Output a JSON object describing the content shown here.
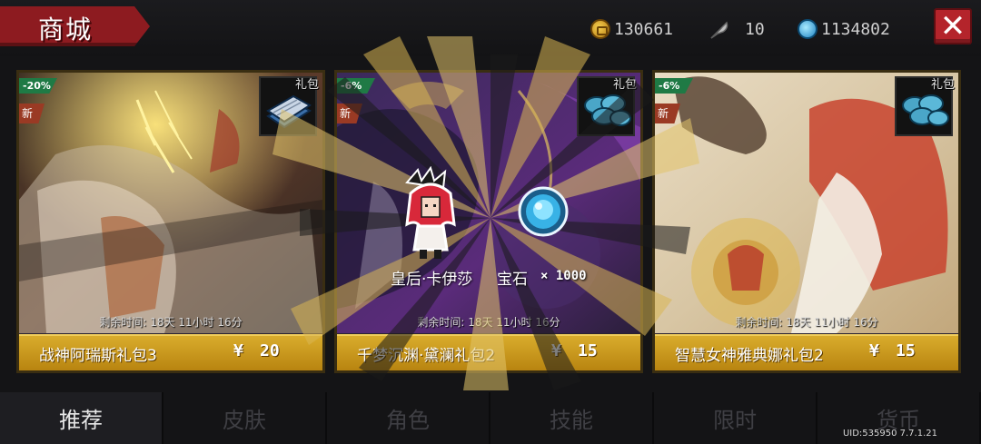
{
  "header": {
    "title": "商城",
    "close_icon": "close-x-icon"
  },
  "currencies": [
    {
      "icon": "gold-coin-icon",
      "value": "130661"
    },
    {
      "icon": "feather-icon",
      "value": "10"
    },
    {
      "icon": "blue-gem-icon",
      "value": "1134802"
    }
  ],
  "cards": [
    {
      "discount": "-20%",
      "new_label": "新",
      "pack_label": "礼包",
      "pack_icon": "book-icon",
      "timer": "剩余时间: 18天 11小时 16分",
      "name": "战神阿瑞斯礼包3",
      "currency_symbol": "¥",
      "price": "20"
    },
    {
      "discount": "-6%",
      "new_label": "新",
      "pack_label": "礼包",
      "pack_icon": "gem-stack-icon",
      "timer": "剩余时间: 18天 11小时 16分",
      "name": "千梦沉渊·黛澜礼包2",
      "currency_symbol": "¥",
      "price": "15"
    },
    {
      "discount": "-6%",
      "new_label": "新",
      "pack_label": "礼包",
      "pack_icon": "gem-stack-icon",
      "timer": "剩余时间: 18天 11小时 16分",
      "name": "智慧女神雅典娜礼包2",
      "currency_symbol": "¥",
      "price": "15"
    }
  ],
  "reward_popup": {
    "items": [
      {
        "icon": "character-sprite-icon",
        "label": "皇后·卡伊莎"
      },
      {
        "icon": "blue-gem-icon",
        "label": "宝石",
        "quantity": "× 1000"
      }
    ]
  },
  "tabs": [
    {
      "label": "推荐",
      "active": true
    },
    {
      "label": "皮肤",
      "active": false
    },
    {
      "label": "角色",
      "active": false
    },
    {
      "label": "技能",
      "active": false
    },
    {
      "label": "限时",
      "active": false
    },
    {
      "label": "货币",
      "active": false
    }
  ],
  "footer": {
    "uid": "UID:535950 7.7.1.21"
  },
  "colors": {
    "banner_red": "#8d1b20",
    "price_gold": "#d9ac2c",
    "discount_green": "#1f7a45"
  }
}
